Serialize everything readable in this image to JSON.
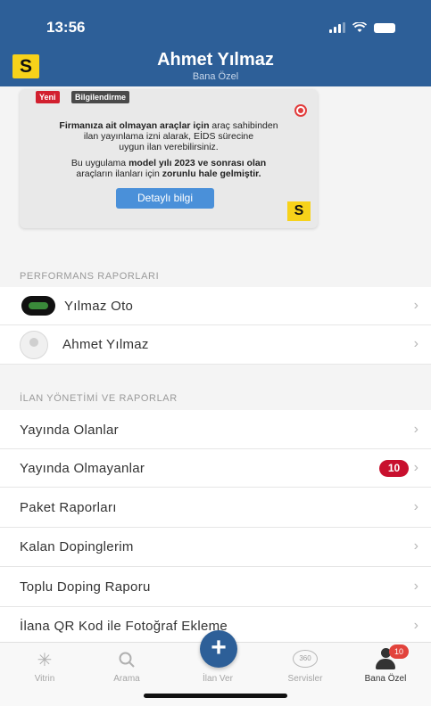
{
  "status_bar": {
    "time": "13:56"
  },
  "header": {
    "title": "Ahmet Yılmaz",
    "subtitle": "Bana Özel",
    "logo": "S"
  },
  "banner": {
    "badge_new": "Yeni",
    "badge_info": "Bilgilendirme",
    "para1_bold": "Firmanıza ait olmayan araçlar için",
    "para1_rest1": " araç sahibinden",
    "para1_line2": "ilan yayınlama izni alarak, EİDS sürecine",
    "para1_line3": "uygun ilan verebilirsiniz.",
    "para2_line1_a": "Bu uygulama ",
    "para2_line1_b": "model yılı 2023 ve sonrası olan",
    "para2_line2_a": "araçların ilanları için ",
    "para2_line2_b": "zorunlu hale gelmiştir.",
    "button": "Detaylı bilgi",
    "logo": "S"
  },
  "performance": {
    "section_title": "PERFORMANS RAPORLARI",
    "items": [
      {
        "label": "Yılmaz Oto"
      },
      {
        "label": "Ahmet Yılmaz"
      }
    ]
  },
  "listings": {
    "section_title": "İLAN YÖNETİMİ VE RAPORLAR",
    "items": [
      {
        "label": "Yayında Olanlar"
      },
      {
        "label": "Yayında Olmayanlar",
        "badge": "10"
      },
      {
        "label": "Paket Raporları"
      },
      {
        "label": "Kalan Dopinglerim"
      },
      {
        "label": "Toplu Doping Raporu"
      },
      {
        "label": "İlana QR Kod ile Fotoğraf Ekleme"
      }
    ]
  },
  "tabbar": {
    "tabs": [
      {
        "label": "Vitrin",
        "icon": "sparkle-icon"
      },
      {
        "label": "Arama",
        "icon": "search-icon"
      },
      {
        "label": "İlan Ver",
        "icon": "plus-icon"
      },
      {
        "label": "Servisler",
        "icon": "360-icon",
        "icon_text": "360"
      },
      {
        "label": "Bana Özel",
        "icon": "person-icon",
        "badge": "10"
      }
    ]
  },
  "colors": {
    "brand_blue": "#2d5f98",
    "accent_yellow": "#f7d21a",
    "badge_red": "#c8102e",
    "button_blue": "#4a90d9"
  }
}
